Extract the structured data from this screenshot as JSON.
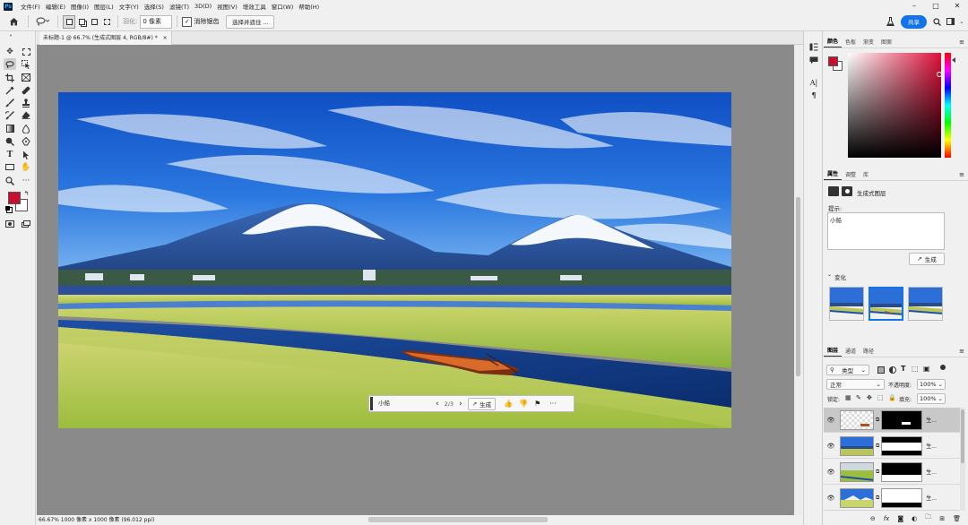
{
  "menubar": {
    "app_icon": "Ps",
    "items": [
      "文件(F)",
      "编辑(E)",
      "图像(I)",
      "图层(L)",
      "文字(Y)",
      "选择(S)",
      "滤镜(T)",
      "3D(D)",
      "视图(V)",
      "增效工具",
      "窗口(W)",
      "帮助(H)"
    ]
  },
  "optionsbar": {
    "feather_label": "羽化:",
    "feather_value": "0 像素",
    "antialias_label": "消除锯齿",
    "select_mask_label": "选择并遮住 ...",
    "share_label": "共享"
  },
  "document": {
    "tab_title": "未标题-1 @ 66.7% (生成式图层 4, RGB/8#) *",
    "status": "66.67%  1000 像素 x 1000 像素 (96.012 ppi)"
  },
  "genbar": {
    "prompt": "小船",
    "counter": "2/3",
    "generate_label": "生成"
  },
  "color_panel": {
    "tabs": [
      "颜色",
      "色板",
      "渐变",
      "图案"
    ],
    "foreground": "#c8102e",
    "background": "#ffffff"
  },
  "properties_panel": {
    "tabs": [
      "属性",
      "调整",
      "库"
    ],
    "layer_type": "生成式图层",
    "prompt_label": "提示:",
    "prompt_value": "小船",
    "generate_label": "生成",
    "variations_label": "变化"
  },
  "layers_panel": {
    "tabs": [
      "图层",
      "通道",
      "路径"
    ],
    "filter_label": "类型",
    "blend_mode": "正常",
    "opacity_label": "不透明度:",
    "opacity_value": "100%",
    "lock_label": "锁定:",
    "fill_label": "填充:",
    "fill_value": "100%",
    "layers": [
      {
        "name": "生..."
      },
      {
        "name": "生..."
      },
      {
        "name": "生..."
      },
      {
        "name": "生..."
      }
    ]
  }
}
